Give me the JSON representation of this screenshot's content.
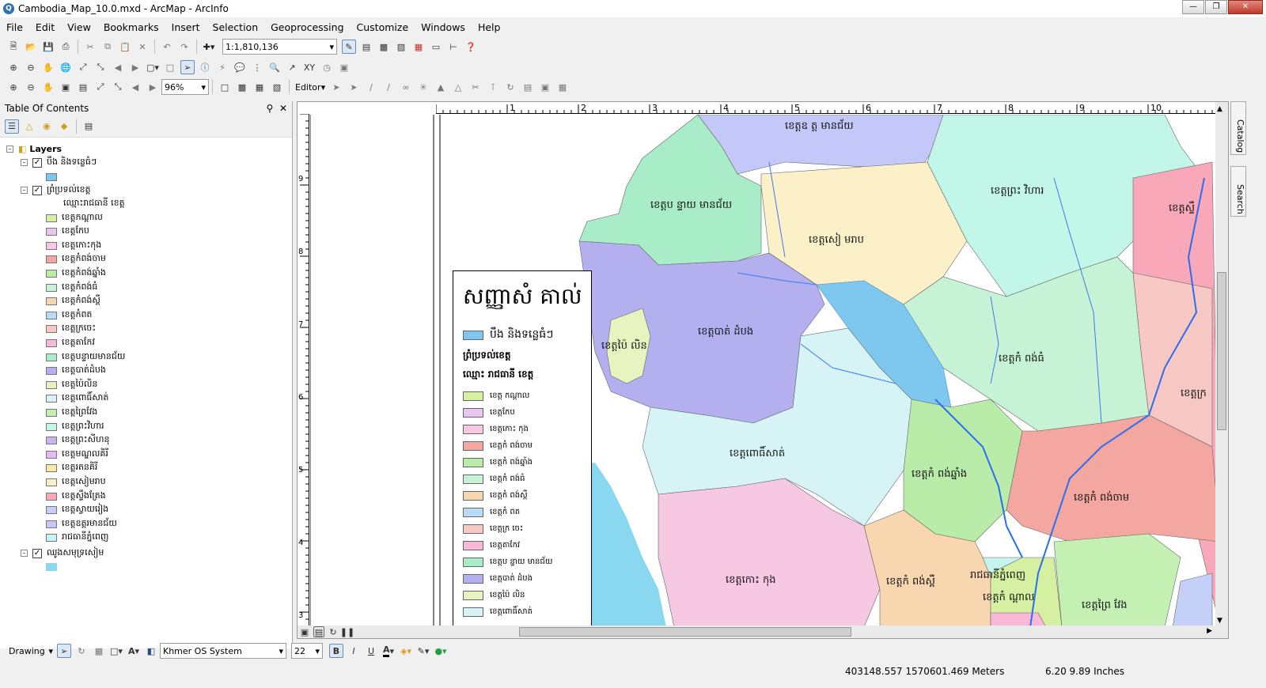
{
  "window": {
    "title": "Cambodia_Map_10.0.mxd - ArcMap - ArcInfo"
  },
  "menu": [
    "File",
    "Edit",
    "View",
    "Bookmarks",
    "Insert",
    "Selection",
    "Geoprocessing",
    "Customize",
    "Windows",
    "Help"
  ],
  "toolbar": {
    "scale": "1:1,810,136",
    "zoom": "96%",
    "editor": "Editor"
  },
  "toc": {
    "title": "Table Of Contents",
    "root": "Layers",
    "layer1": {
      "name": "បឹង និងទន្លេធំៗ",
      "color": "#7ec8f0"
    },
    "layer2": {
      "name": "ព្រំប្រទល់ខេត្ត",
      "field": "ឈ្មោះរាជធានី ខេត្ត",
      "classes": [
        {
          "label": "ខេត្តកណ្ដាល",
          "color": "#d4f0a0"
        },
        {
          "label": "ខេត្តកែប",
          "color": "#e8c6f0"
        },
        {
          "label": "ខេត្តកោះកុង",
          "color": "#f6c8e2"
        },
        {
          "label": "ខេត្តកំពង់ចាម",
          "color": "#f4a6a0"
        },
        {
          "label": "ខេត្តកំពង់ឆ្នាំង",
          "color": "#b8eca8"
        },
        {
          "label": "ខេត្តកំពង់ធំ",
          "color": "#c6f2d6"
        },
        {
          "label": "ខេត្តកំពង់ស្ពឺ",
          "color": "#f8d6b0"
        },
        {
          "label": "ខេត្តកំពត",
          "color": "#b8dcf8"
        },
        {
          "label": "ខេត្តក្រចេះ",
          "color": "#f8c8c4"
        },
        {
          "label": "ខេត្តតាកែវ",
          "color": "#f8b8d8"
        },
        {
          "label": "ខេត្តបន្ទាយមានជ័យ",
          "color": "#a8ecc8"
        },
        {
          "label": "ខេត្តបាត់ដំបង",
          "color": "#b4b0f0"
        },
        {
          "label": "ខេត្តប៉ៃលិន",
          "color": "#e8f4c0"
        },
        {
          "label": "ខេត្តពោធិ៍សាត់",
          "color": "#d6f4f6"
        },
        {
          "label": "ខេត្តព្រៃវែង",
          "color": "#c4f0b4"
        },
        {
          "label": "ខេត្តព្រះវិហារ",
          "color": "#c2f6e8"
        },
        {
          "label": "ខេត្តព្រះសីហនុ",
          "color": "#c8b4f0"
        },
        {
          "label": "ខេត្តមណ្ឌលគិរី",
          "color": "#e8b8f4"
        },
        {
          "label": "ខេត្តរតនគិរី",
          "color": "#fce6a8"
        },
        {
          "label": "ខេត្តសៀមរាប",
          "color": "#fcf0c8"
        },
        {
          "label": "ខេត្តស្ទឹងត្រែង",
          "color": "#f8a8b8"
        },
        {
          "label": "ខេត្តស្វាយរៀង",
          "color": "#c4d0f8"
        },
        {
          "label": "ខេត្តឧត្តរមានជ័យ",
          "color": "#c4c8f8"
        },
        {
          "label": "រាជធានីភ្នំពេញ",
          "color": "#c8f4f0"
        }
      ]
    },
    "layer3": {
      "name": "ឈូងសមុទ្រសៀម",
      "color": "#8ad8f0"
    }
  },
  "legend": {
    "title": "សញ្ញាសំ   គាល់",
    "water_label": "បឹង និងទន្លេធំៗ",
    "boundary_label": "ព្រំប្រទល់ខេត្ត",
    "field_label": "ឈ្មោះ  រាជធានី ខេត្ត",
    "items": [
      {
        "label": "ខេត្ត  កណ្ដាល",
        "color": "#d4f0a0"
      },
      {
        "label": "ខេត្តកែប",
        "color": "#e8c6f0"
      },
      {
        "label": "ខេត្តកោះ    កុង",
        "color": "#f6c8e2"
      },
      {
        "label": "ខេត្តកំ  ពង់ចាម",
        "color": "#f4a6a0"
      },
      {
        "label": "ខេត្តកំ  ពង់ឆ្នាំង",
        "color": "#b8eca8"
      },
      {
        "label": "ខេត្តកំ  ពង់ធំ",
        "color": "#c6f2d6"
      },
      {
        "label": "ខេត្តកំ  ពង់ស្ពឺ",
        "color": "#f8d6b0"
      },
      {
        "label": "ខេត្តកំ  ពត",
        "color": "#b8dcf8"
      },
      {
        "label": "ខេត្តក្រ  ចេះ",
        "color": "#f8c8c4"
      },
      {
        "label": "ខេត្តតាកែវ",
        "color": "#f8b8d8"
      },
      {
        "label": "ខេត្តប  ន្ទាយ  មានជ័យ",
        "color": "#a8ecc8"
      },
      {
        "label": "ខេត្តបាត់  ដំបង",
        "color": "#b4b0f0"
      },
      {
        "label": "ខេត្តប៉ៃ  លិន",
        "color": "#e8f4c0"
      },
      {
        "label": "ខេត្តពោធិ៍សាត់",
        "color": "#d6f4f6"
      }
    ]
  },
  "map_labels": {
    "oddar": "ខេត្តឧ  ត្ត  មានជ័យ",
    "banteay": "ខេត្តប  ន្ទាយ  មានជ័យ",
    "siemreap": "ខេត្តសៀ    មរាប",
    "preahvihear": "ខេត្តព្រះ  វិហារ",
    "stung": "ខេត្តស្ទឹ",
    "battambang": "ខេត្តបាត់  ដំបង",
    "pailin": "ខេត្តប៉ៃ  លិន",
    "kthom": "ខេត្តកំ  ពង់ធំ",
    "kratie": "ខេត្តក្រ",
    "pursat": "ខេត្តពោធិ៍សាត់",
    "kchhnang": "ខេត្តកំ  ពង់ឆ្នាំង",
    "kcham": "ខេត្តកំ  ពង់ចាម",
    "kokong": "ខេត្តកោះ    កុង",
    "kspeu": "ខេត្តកំ  ពង់ស្ពឺ",
    "pp": "រាជធានីភ្នំពេញ",
    "kandal": "ខេត្តកំ  ណ្តាល",
    "preyveng": "ខេត្តព្រៃ  វែង"
  },
  "ruler_h": [
    "1",
    "2",
    "3",
    "4",
    "5",
    "6",
    "7",
    "8",
    "9",
    "10"
  ],
  "ruler_v": [
    "9",
    "8",
    "7",
    "6",
    "5",
    "4",
    "3"
  ],
  "drawing": {
    "label": "Drawing",
    "font": "Khmer OS System",
    "size": "22"
  },
  "status": {
    "coords": "403148.557  1570601.469 Meters",
    "page": "6.20  9.89 Inches"
  },
  "sidetabs": [
    "Catalog",
    "Search"
  ]
}
